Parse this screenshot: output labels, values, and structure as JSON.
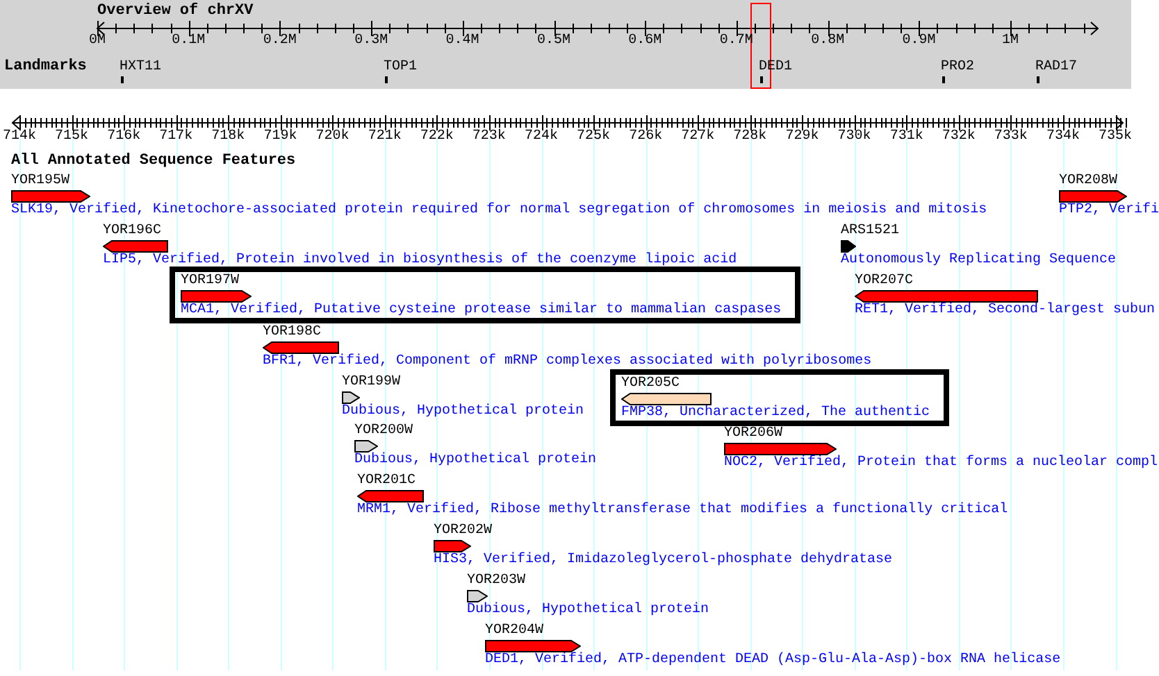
{
  "overview": {
    "title": "Overview of chrXV",
    "ticks": [
      "0M",
      "0.1M",
      "0.2M",
      "0.3M",
      "0.4M",
      "0.5M",
      "0.6M",
      "0.7M",
      "0.8M",
      "0.9M",
      "1M"
    ]
  },
  "landmarks": {
    "label": "Landmarks",
    "items": [
      {
        "name": "HXT11"
      },
      {
        "name": "TOP1"
      },
      {
        "name": "DED1"
      },
      {
        "name": "PRO2"
      },
      {
        "name": "RAD17"
      }
    ]
  },
  "ruler": {
    "ticks": [
      "714k",
      "715k",
      "716k",
      "717k",
      "718k",
      "719k",
      "720k",
      "721k",
      "722k",
      "723k",
      "724k",
      "725k",
      "726k",
      "727k",
      "728k",
      "729k",
      "730k",
      "731k",
      "732k",
      "733k",
      "734k",
      "735k"
    ]
  },
  "section_title": "All Annotated Sequence Features",
  "features": [
    {
      "name": "YOR195W",
      "description": "SLK19, Verified, Kinetochore-associated protein required for normal segregation of chromosomes in meiosis and mitosis",
      "reverse_strand": false,
      "color": "#ff0000",
      "highlighted": false
    },
    {
      "name": "YOR208W",
      "description": "PTP2, Verifi",
      "reverse_strand": false,
      "color": "#ff0000",
      "highlighted": false
    },
    {
      "name": "YOR196C",
      "description": "LIP5, Verified, Protein involved in biosynthesis of the coenzyme lipoic acid",
      "reverse_strand": true,
      "color": "#ff0000",
      "highlighted": false
    },
    {
      "name": "ARS1521",
      "description": "Autonomously Replicating Sequence",
      "reverse_strand": false,
      "color": "#000000",
      "highlighted": false
    },
    {
      "name": "YOR197W",
      "description": "MCA1, Verified, Putative cysteine protease similar to mammalian caspases",
      "reverse_strand": false,
      "color": "#ff0000",
      "highlighted": true
    },
    {
      "name": "YOR207C",
      "description": "RET1, Verified, Second-largest subun",
      "reverse_strand": true,
      "color": "#ff0000",
      "highlighted": false
    },
    {
      "name": "YOR198C",
      "description": "BFR1, Verified, Component of mRNP complexes associated with polyribosomes",
      "reverse_strand": true,
      "color": "#ff0000",
      "highlighted": false
    },
    {
      "name": "YOR199W",
      "description": "Dubious, Hypothetical protein",
      "reverse_strand": false,
      "color": "#d3d3d3",
      "highlighted": false
    },
    {
      "name": "YOR205C",
      "description": "FMP38, Uncharacterized, The authentic",
      "reverse_strand": true,
      "color": "#ffdab9",
      "highlighted": true
    },
    {
      "name": "YOR200W",
      "description": "Dubious, Hypothetical protein",
      "reverse_strand": false,
      "color": "#d3d3d3",
      "highlighted": false
    },
    {
      "name": "YOR206W",
      "description": "NOC2, Verified, Protein that forms a nucleolar compl",
      "reverse_strand": false,
      "color": "#ff0000",
      "highlighted": false
    },
    {
      "name": "YOR201C",
      "description": "MRM1, Verified, Ribose methyltransferase that modifies a functionally critical",
      "reverse_strand": true,
      "color": "#ff0000",
      "highlighted": false
    },
    {
      "name": "YOR202W",
      "description": "HIS3, Verified, Imidazoleglycerol-phosphate dehydratase",
      "reverse_strand": false,
      "color": "#ff0000",
      "highlighted": false
    },
    {
      "name": "YOR203W",
      "description": "Dubious, Hypothetical protein",
      "reverse_strand": false,
      "color": "#d3d3d3",
      "highlighted": false
    },
    {
      "name": "YOR204W",
      "description": "DED1, Verified, ATP-dependent DEAD (Asp-Glu-Ala-Asp)-box RNA helicase",
      "reverse_strand": false,
      "color": "#ff0000",
      "highlighted": false
    }
  ]
}
